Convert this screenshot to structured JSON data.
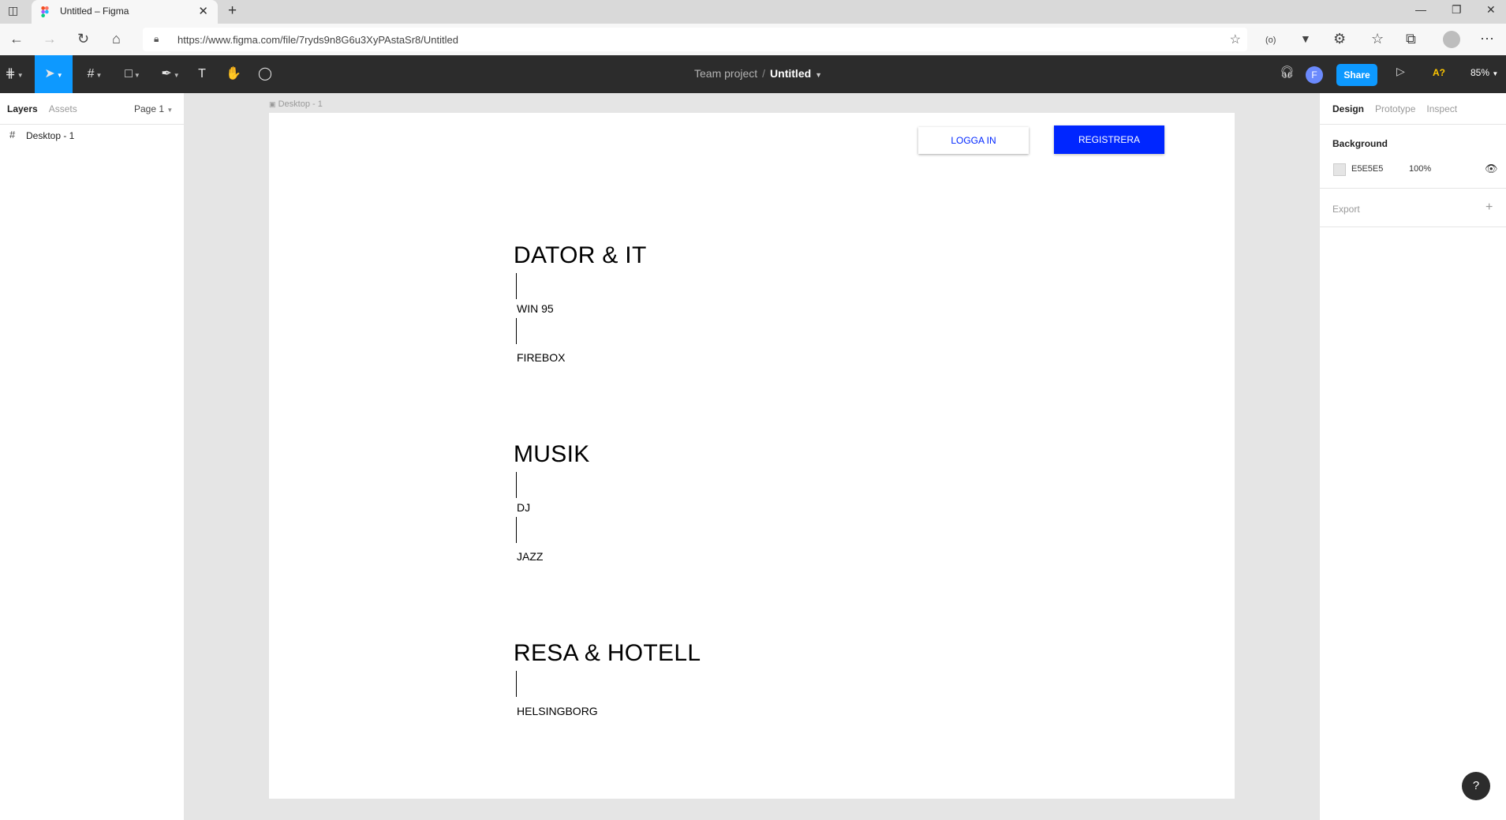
{
  "browser": {
    "tab_title": "Untitled – Figma",
    "url": "https://www.figma.com/file/7ryds9n8G6u3XyPAstaSr8/Untitled"
  },
  "toolbar": {
    "project": "Team project",
    "file_name": "Untitled",
    "avatar_initial": "F",
    "share_label": "Share",
    "aq_label": "A?",
    "zoom": "85%"
  },
  "left_panel": {
    "tab_layers": "Layers",
    "tab_assets": "Assets",
    "page": "Page 1",
    "layers": [
      {
        "name": "Desktop - 1"
      }
    ]
  },
  "right_panel": {
    "tabs": [
      "Design",
      "Prototype",
      "Inspect"
    ],
    "background_label": "Background",
    "background_hex": "E5E5E5",
    "background_opacity": "100%",
    "export_label": "Export"
  },
  "canvas": {
    "frame_label": "Desktop - 1",
    "login_label": "LOGGA IN",
    "register_label": "REGISTRERA",
    "sections": [
      {
        "heading": "DATOR & IT",
        "items": [
          "WIN 95",
          "FIREBOX"
        ]
      },
      {
        "heading": "MUSIK",
        "items": [
          "DJ",
          "JAZZ"
        ]
      },
      {
        "heading": "RESA & HOTELL",
        "items": [
          "HELSINGBORG"
        ]
      }
    ]
  },
  "colors": {
    "figma_toolbar": "#2c2c2c",
    "figma_accent": "#0d99ff",
    "register_button": "#0026ff",
    "canvas_bg": "#e5e5e5"
  },
  "icons": [
    "sidebar-toggle-icon",
    "figma-logo-icon",
    "close-icon",
    "plus-icon",
    "back-icon",
    "forward-icon",
    "reload-icon",
    "home-icon",
    "lock-icon",
    "star-icon",
    "menu-icon",
    "move-icon",
    "frame-icon",
    "shape-icon",
    "pen-icon",
    "text-icon",
    "hand-icon",
    "comment-icon",
    "headphones-icon",
    "play-icon",
    "eye-icon",
    "help-icon"
  ],
  "help_label": "?"
}
